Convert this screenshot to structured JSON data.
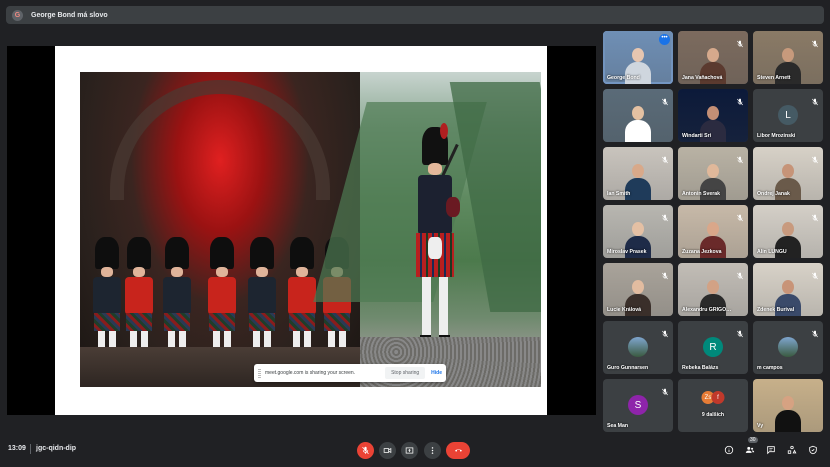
{
  "banner": {
    "avatar_initial": "G",
    "text": "George Bond má slovo"
  },
  "presentation": {
    "share_bar": {
      "message": "meet.google.com is sharing your screen.",
      "stop_label": "Stop sharing",
      "hide_label": "Hide"
    }
  },
  "participants": [
    {
      "name": "George Bond",
      "kind": "video",
      "active": true,
      "more": "•••"
    },
    {
      "name": "Jana Vaňachová",
      "kind": "video",
      "muted": true
    },
    {
      "name": "Steven Arnett",
      "kind": "video",
      "muted": true
    },
    {
      "name": "",
      "kind": "video",
      "muted": true
    },
    {
      "name": "Windarti Sri",
      "kind": "video",
      "muted": true
    },
    {
      "name": "Libor Mrozinski",
      "kind": "avatar",
      "initial": "L",
      "color": "#455a64",
      "muted": true
    },
    {
      "name": "Ian Smith",
      "kind": "video",
      "muted": true
    },
    {
      "name": "Antonin Sverak",
      "kind": "video",
      "muted": true
    },
    {
      "name": "Ondrej Janak",
      "kind": "video",
      "muted": true
    },
    {
      "name": "Miroslav Prasek",
      "kind": "video",
      "muted": true
    },
    {
      "name": "Zuzana Jezkova",
      "kind": "video",
      "muted": true
    },
    {
      "name": "Alin LUNGU",
      "kind": "video",
      "muted": true
    },
    {
      "name": "Lucie Králová",
      "kind": "video",
      "muted": true
    },
    {
      "name": "Alexandru GRIGO…",
      "kind": "video",
      "muted": true
    },
    {
      "name": "Zdenek Burival",
      "kind": "video",
      "muted": true
    },
    {
      "name": "Guro Gunnarsen",
      "kind": "photo",
      "muted": true
    },
    {
      "name": "Rebeka Balázs",
      "kind": "avatar",
      "initial": "R",
      "color": "#00897b",
      "muted": true
    },
    {
      "name": "m campos",
      "kind": "photo",
      "muted": true
    },
    {
      "name": "Sea Man",
      "kind": "avatar",
      "initial": "S",
      "color": "#8e24aa",
      "muted": true
    },
    {
      "name": "9 dalších",
      "kind": "group",
      "initials": [
        "Zs",
        "f"
      ]
    },
    {
      "name": "Vy",
      "kind": "video"
    }
  ],
  "bottom": {
    "time": "13:09",
    "meeting_code": "jgc-qidn-dip",
    "people_count": "30",
    "colors": {
      "end_call": "#ea4335",
      "mic_off": "#ea4335"
    }
  }
}
